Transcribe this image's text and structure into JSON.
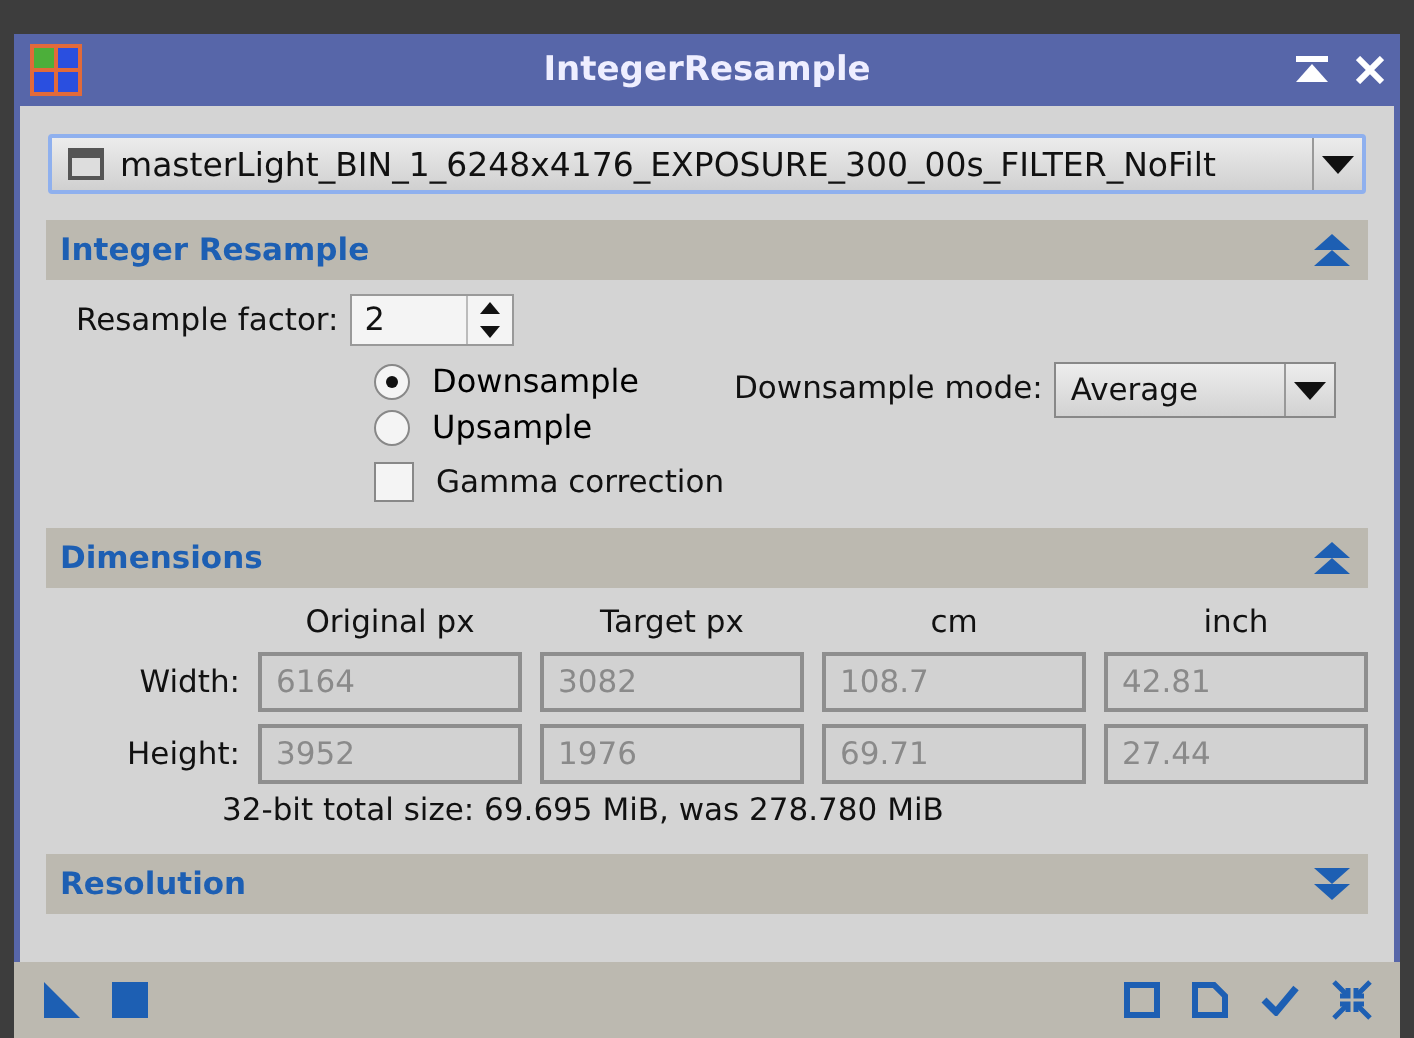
{
  "window": {
    "title": "IntegerResample"
  },
  "view_selector": {
    "value": "masterLight_BIN_1_6248x4176_EXPOSURE_300_00s_FILTER_NoFilt"
  },
  "integer_resample": {
    "title": "Integer Resample",
    "expanded": true,
    "factor_label": "Resample factor:",
    "factor_value": "2",
    "modes": [
      {
        "label": "Downsample",
        "selected": true
      },
      {
        "label": "Upsample",
        "selected": false
      }
    ],
    "downsample_mode_label": "Downsample mode:",
    "downsample_mode_value": "Average",
    "gamma": {
      "label": "Gamma correction",
      "checked": false
    }
  },
  "dimensions": {
    "title": "Dimensions",
    "expanded": true,
    "columns": [
      "Original px",
      "Target px",
      "cm",
      "inch"
    ],
    "rows": [
      {
        "label": "Width:",
        "values": [
          "6164",
          "3082",
          "108.7",
          "42.81"
        ]
      },
      {
        "label": "Height:",
        "values": [
          "3952",
          "1976",
          "69.71",
          "27.44"
        ]
      }
    ],
    "size_note": "32-bit total size: 69.695 MiB, was 278.780 MiB"
  },
  "resolution": {
    "title": "Resolution",
    "expanded": false
  }
}
